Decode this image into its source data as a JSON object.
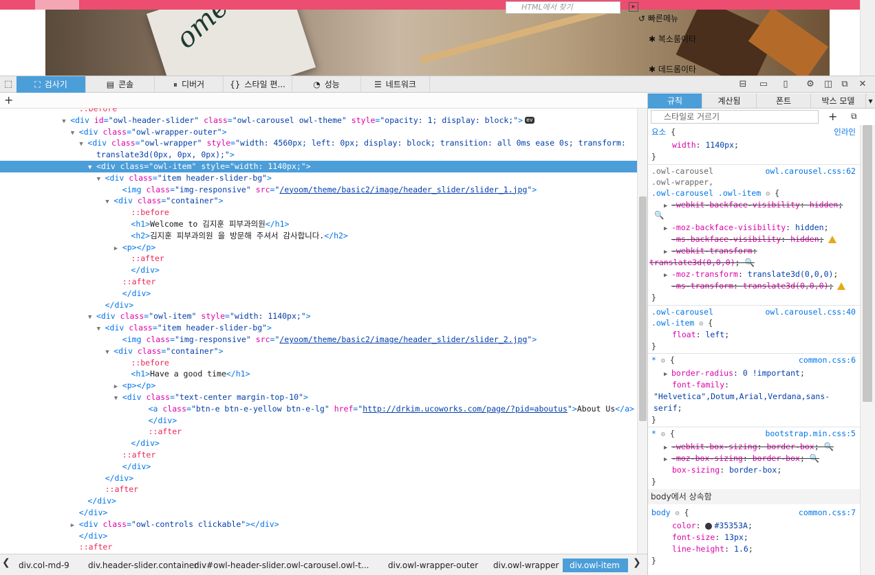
{
  "preview": {
    "quick_menu_title": "빠른메뉴",
    "quick_items": [
      "복소룸이타",
      "데드롬이타"
    ],
    "paper_script": "ome"
  },
  "toolbar": {
    "tabs": [
      {
        "label": "검사기",
        "icon": "inspector-icon"
      },
      {
        "label": "콘솔",
        "icon": "console-icon"
      },
      {
        "label": "디버거",
        "icon": "debugger-icon"
      },
      {
        "label": "스타일 편...",
        "icon": "style-editor-icon"
      },
      {
        "label": "성능",
        "icon": "performance-icon"
      },
      {
        "label": "네트워크",
        "icon": "network-icon"
      }
    ]
  },
  "markup": {
    "search_placeholder": "HTML에서 찾기",
    "lines": [
      {
        "indent": 8,
        "html": "<span class='ps'>::before</span>"
      },
      {
        "indent": 7,
        "tw": "▼",
        "html": "<span class='tg'>&lt;div</span> <span class='an'>id</span><span class='tg'>=</span><span class='av'>\"owl-header-slider\"</span> <span class='an'>class</span><span class='tg'>=</span><span class='av'>\"owl-carousel owl-theme\"</span> <span class='an'>style</span><span class='tg'>=</span><span class='av'>\"opacity: 1; display: block;\"</span><span class='tg'>&gt;</span><span class='ev'>ev</span>"
      },
      {
        "indent": 8,
        "tw": "▼",
        "html": "<span class='tg'>&lt;div</span> <span class='an'>class</span><span class='tg'>=</span><span class='av'>\"owl-wrapper-outer\"</span><span class='tg'>&gt;</span>"
      },
      {
        "indent": 9,
        "tw": "▼",
        "html": "<span class='tg'>&lt;div</span> <span class='an'>class</span><span class='tg'>=</span><span class='av'>\"owl-wrapper\"</span> <span class='an'>style</span><span class='tg'>=</span><span class='av'>\"width: 4560px; left: 0px; display: block; transition: all 0ms ease 0s; transform:</span>"
      },
      {
        "indent": 10,
        "html": "<span class='av'>translate3d(0px, 0px, 0px);\"</span><span class='tg'>&gt;</span>"
      },
      {
        "indent": 10,
        "tw": "▼",
        "sel": true,
        "html": "<span class='tg'>&lt;div</span> <span class='an'>class</span><span class='tg'>=</span><span class='av'>\"owl-item\"</span> <span class='an'>style</span><span class='tg'>=</span><span class='av'>\"width: 1140px;\"</span><span class='tg'>&gt;</span>"
      },
      {
        "indent": 11,
        "tw": "▼",
        "html": "<span class='tg'>&lt;div</span> <span class='an'>class</span><span class='tg'>=</span><span class='av'>\"item header-slider-bg\"</span><span class='tg'>&gt;</span>"
      },
      {
        "indent": 13,
        "html": "<span class='tg'>&lt;img</span> <span class='an'>class</span><span class='tg'>=</span><span class='av'>\"img-responsive\"</span> <span class='an'>src</span><span class='tg'>=</span><span class='av'>\"</span><span class='lk'>/eyoom/theme/basic2/image/header_slider/slider_1.jpg</span><span class='av'>\"</span><span class='tg'>&gt;</span>"
      },
      {
        "indent": 12,
        "tw": "▼",
        "html": "<span class='tg'>&lt;div</span> <span class='an'>class</span><span class='tg'>=</span><span class='av'>\"container\"</span><span class='tg'>&gt;</span>"
      },
      {
        "indent": 14,
        "html": "<span class='ps'>::before</span>"
      },
      {
        "indent": 14,
        "html": "<span class='tg'>&lt;h1&gt;</span><span class='tx'>Welcome to 김지훈 피부과의원</span><span class='tg'>&lt;/h1&gt;</span>"
      },
      {
        "indent": 14,
        "html": "<span class='tg'>&lt;h2&gt;</span><span class='tx'>김지훈 피부과의원 을 방문해 주셔서 감사합니다.</span><span class='tg'>&lt;/h2&gt;</span>"
      },
      {
        "indent": 13,
        "tw": "▶",
        "html": "<span class='tg'>&lt;p&gt;&lt;/p&gt;</span>"
      },
      {
        "indent": 14,
        "html": "<span class='ps'>::after</span>"
      },
      {
        "indent": 14,
        "html": "<span class='tg'>&lt;/div&gt;</span>"
      },
      {
        "indent": 13,
        "html": "<span class='ps'>::after</span>"
      },
      {
        "indent": 13,
        "html": "<span class='tg'>&lt;/div&gt;</span>"
      },
      {
        "indent": 11,
        "html": "<span class='tg'>&lt;/div&gt;</span>"
      },
      {
        "indent": 10,
        "tw": "▼",
        "html": "<span class='tg'>&lt;div</span> <span class='an'>class</span><span class='tg'>=</span><span class='av'>\"owl-item\"</span> <span class='an'>style</span><span class='tg'>=</span><span class='av'>\"width: 1140px;\"</span><span class='tg'>&gt;</span>"
      },
      {
        "indent": 11,
        "tw": "▼",
        "html": "<span class='tg'>&lt;div</span> <span class='an'>class</span><span class='tg'>=</span><span class='av'>\"item header-slider-bg\"</span><span class='tg'>&gt;</span>"
      },
      {
        "indent": 13,
        "html": "<span class='tg'>&lt;img</span> <span class='an'>class</span><span class='tg'>=</span><span class='av'>\"img-responsive\"</span> <span class='an'>src</span><span class='tg'>=</span><span class='av'>\"</span><span class='lk'>/eyoom/theme/basic2/image/header_slider/slider_2.jpg</span><span class='av'>\"</span><span class='tg'>&gt;</span>"
      },
      {
        "indent": 12,
        "tw": "▼",
        "html": "<span class='tg'>&lt;div</span> <span class='an'>class</span><span class='tg'>=</span><span class='av'>\"container\"</span><span class='tg'>&gt;</span>"
      },
      {
        "indent": 14,
        "html": "<span class='ps'>::before</span>"
      },
      {
        "indent": 14,
        "html": "<span class='tg'>&lt;h1&gt;</span><span class='tx'>Have a good time</span><span class='tg'>&lt;/h1&gt;</span>"
      },
      {
        "indent": 13,
        "tw": "▶",
        "html": "<span class='tg'>&lt;p&gt;&lt;/p&gt;</span>"
      },
      {
        "indent": 13,
        "tw": "▼",
        "html": "<span class='tg'>&lt;div</span> <span class='an'>class</span><span class='tg'>=</span><span class='av'>\"text-center margin-top-10\"</span><span class='tg'>&gt;</span>"
      },
      {
        "indent": 16,
        "html": "<span class='tg'>&lt;a</span> <span class='an'>class</span><span class='tg'>=</span><span class='av'>\"btn-e btn-e-yellow btn-e-lg\"</span> <span class='an'>href</span><span class='tg'>=</span><span class='av'>\"</span><span class='lk'>http://drkim.ucoworks.com/page/?pid=aboutus</span><span class='av'>\"</span><span class='tg'>&gt;</span><span class='tx'>About Us</span><span class='tg'>&lt;/a&gt;</span>"
      },
      {
        "indent": 16,
        "html": "<span class='tg'>&lt;/div&gt;</span>"
      },
      {
        "indent": 16,
        "html": "<span class='ps'>::after</span>"
      },
      {
        "indent": 14,
        "html": "<span class='tg'>&lt;/div&gt;</span>"
      },
      {
        "indent": 13,
        "html": "<span class='ps'>::after</span>"
      },
      {
        "indent": 13,
        "html": "<span class='tg'>&lt;/div&gt;</span>"
      },
      {
        "indent": 11,
        "html": "<span class='tg'>&lt;/div&gt;</span>"
      },
      {
        "indent": 11,
        "html": "<span class='ps'>::after</span>"
      },
      {
        "indent": 9,
        "html": "<span class='tg'>&lt;/div&gt;</span>"
      },
      {
        "indent": 8,
        "html": "<span class='tg'>&lt;/div&gt;</span>"
      },
      {
        "indent": 8,
        "tw": "▶",
        "html": "<span class='tg'>&lt;div</span> <span class='an'>class</span><span class='tg'>=</span><span class='av'>\"owl-controls clickable\"</span><span class='tg'>&gt;&lt;/div&gt;</span>"
      },
      {
        "indent": 8,
        "html": "<span class='tg'>&lt;/div&gt;</span>"
      },
      {
        "indent": 8,
        "html": "<span class='ps'>::after</span>"
      }
    ]
  },
  "breadcrumbs": [
    "div.col-md-9",
    "div.header-slider.container",
    "div#owl-header-slider.owl-carousel.owl-t...",
    "div.owl-wrapper-outer",
    "div.owl-wrapper",
    "div.owl-item"
  ],
  "side": {
    "tabs": [
      "규칙",
      "계산됨",
      "폰트",
      "박스 모델"
    ],
    "filter_placeholder": "스타일로 거르기",
    "inherited_label": "body에서 상속함",
    "swatch_color": "#35353A"
  }
}
